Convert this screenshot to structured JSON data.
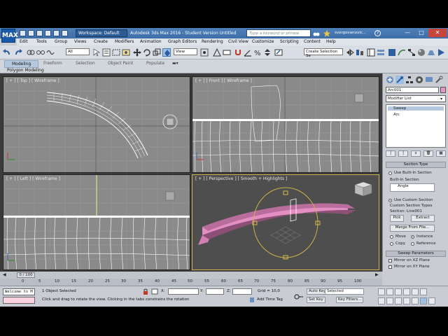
{
  "title_bar": {
    "app_logo": "MAX",
    "workspace": "Workspace: Default",
    "title": "Autodesk 3ds Max 2016 - Student Version     Untitled",
    "search_placeholder": "Type a keyword or phrase",
    "user": "svergovanovic...",
    "help": "?"
  },
  "menu": [
    "Edit",
    "Tools",
    "Group",
    "Views",
    "Create",
    "Modifiers",
    "Animation",
    "Graph Editors",
    "Rendering",
    "Civil View",
    "Customize",
    "Scripting",
    "Content",
    "Help"
  ],
  "toolbar": {
    "selection_filter": "All",
    "reference_coord": "View",
    "named_selection": "Create Selection Se"
  },
  "ribbon": {
    "tabs": [
      "Modeling",
      "Freeform",
      "Selection",
      "Object Paint",
      "Populate"
    ],
    "sub_label": "Polygon Modeling"
  },
  "viewports": {
    "top": "[ + ] [ Top ] [ Wireframe ]",
    "front": "[ + ] [ Front ] [ Wireframe ]",
    "left": "[ + ] [ Left ] [ Wireframe ]",
    "perspective": "[ + ] [ Perspective ] [ Smooth + Highlights ]"
  },
  "command_panel": {
    "object_name": "Arc001",
    "object_color": "#e896c7",
    "modifier_list": "Modifier List",
    "stack": [
      "Sweep",
      "Arc"
    ],
    "section_type": {
      "title": "Section Type",
      "use_builtin": "Use Built-In Section",
      "builtin_label": "Built-In Section",
      "builtin_value": "Angle",
      "use_custom": "Use Custom Section",
      "custom_types": "Custom Section Types",
      "section_name": "Section: Line001",
      "pick": "Pick",
      "extract": "Extract",
      "merge": "Merge From File...",
      "move": "Move",
      "instance": "Instance",
      "copy": "Copy",
      "reference": "Reference"
    },
    "sweep_params": {
      "title": "Sweep Parameters",
      "mirror_xz": "Mirror on XZ Plane",
      "mirror_xy": "Mirror on XY Plane"
    }
  },
  "timeline": {
    "frame_counter": "0 / 100",
    "ticks": [
      "0",
      "5",
      "10",
      "15",
      "20",
      "25",
      "30",
      "35",
      "40",
      "45",
      "50",
      "55",
      "60",
      "65",
      "70",
      "75",
      "80",
      "85",
      "90",
      "95",
      "100"
    ]
  },
  "status": {
    "maxscript": "Welcome to M",
    "selected": "1 Object Selected",
    "prompt": "Click and drag to rotate the view.  Clicking in the tabs constrains the rotation",
    "x_label": "X:",
    "y_label": "Y:",
    "z_label": "Z:",
    "grid": "Grid = 10,0",
    "add_time_tag": "Add Time Tag",
    "auto_key": "Auto Key",
    "selected_dropdown": "Selected",
    "set_key": "Set Key",
    "key_filters": "Key Filters..."
  }
}
